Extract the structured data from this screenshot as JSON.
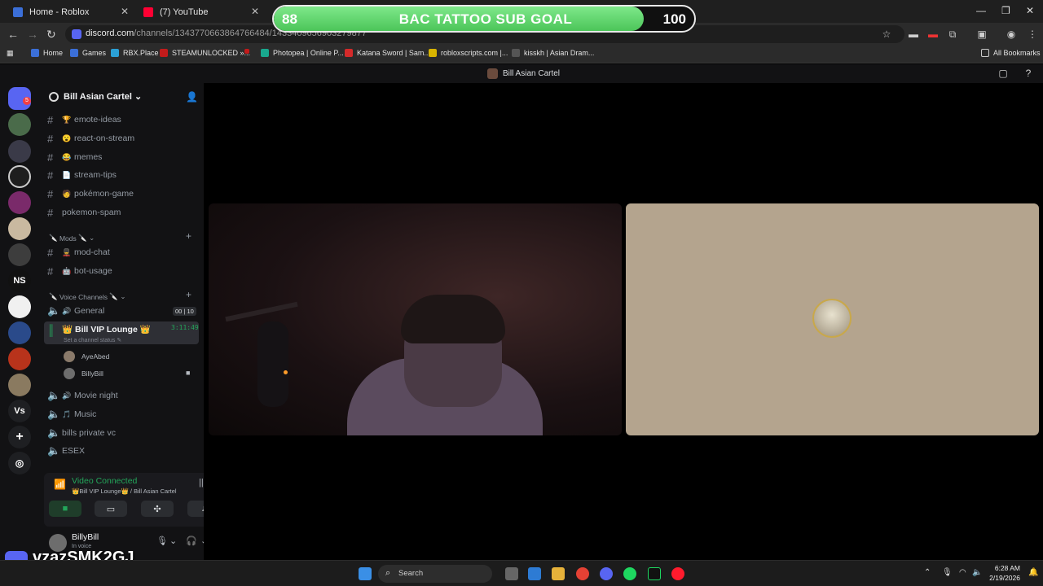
{
  "browser": {
    "tabs": [
      {
        "label": "Home - Roblox",
        "icon": "roblox-icon",
        "color": "#3b6fd8"
      },
      {
        "label": "(7) YouTube",
        "icon": "youtube-icon",
        "color": "#ff0033"
      }
    ],
    "url_main": "discord.com",
    "url_rest": "/channels/1343770663864766484/1433409656903279877",
    "bookmarks": [
      {
        "label": "Home",
        "color": "#3b6fd8"
      },
      {
        "label": "Games",
        "color": "#3b6fd8"
      },
      {
        "label": "RBX.Place",
        "color": "#2ba0d6"
      },
      {
        "label": "STEAMUNLOCKED »...",
        "color": "#c21b1b"
      },
      {
        "label": "Photopea | Online P...",
        "color": "#19a88e"
      },
      {
        "label": "Katana Sword | Sam...",
        "color": "#d42a2a"
      },
      {
        "label": "robloxscripts.com |...",
        "color": "#d8b400"
      },
      {
        "label": "kisskh | Asian Dram...",
        "color": "#555555"
      }
    ],
    "all_bookmarks": "All Bookmarks"
  },
  "goal": {
    "current": "88",
    "title": "BAC TATTOO SUB GOAL",
    "target": "100",
    "progress": 0.88
  },
  "discord": {
    "server_title": "Bill Asian Cartel",
    "server_name": "Bill Asian Cartel",
    "notification_count": "5",
    "text_channels": [
      {
        "emoji": "🏆",
        "name": "emote-ideas"
      },
      {
        "emoji": "😮",
        "name": "react-on-stream"
      },
      {
        "emoji": "😂",
        "name": "memes"
      },
      {
        "emoji": "📄",
        "name": "stream-tips"
      },
      {
        "emoji": "🧑",
        "name": "pokémon-game"
      },
      {
        "emoji": "",
        "name": "pokemon-spam"
      }
    ],
    "mods_category": "Mods",
    "mod_channels": [
      {
        "emoji": "💂",
        "name": "mod-chat"
      },
      {
        "emoji": "🤖",
        "name": "bot-usage"
      }
    ],
    "voice_category": "Voice Channels",
    "voice_general": {
      "emoji": "🔊",
      "name": "General",
      "count_a": "00",
      "count_b": "10"
    },
    "voice_active": {
      "name": "👑 Bill VIP Lounge 👑",
      "timer": "3:11:49",
      "status_hint": "Set a channel status"
    },
    "voice_users": [
      {
        "name": "AyeAbed",
        "color": "#8a7a6a"
      },
      {
        "name": "BillyBill",
        "color": "#6d6d6d"
      }
    ],
    "other_voice": [
      {
        "emoji": "🔊",
        "name": "Movie night"
      },
      {
        "emoji": "🎵",
        "name": "Music"
      },
      {
        "emoji": "",
        "name": "bills private vc"
      },
      {
        "emoji": "",
        "name": "ESEX"
      }
    ],
    "voice_panel": {
      "status": "Video Connected",
      "location": "👑Bill VIP Lounge👑 / Bill Asian Cartel"
    },
    "user": {
      "name": "BillyBill",
      "status": "In voice"
    },
    "guild_labels": {
      "ns": "NS",
      "vs": "Vs"
    }
  },
  "watermark": "vzazSMK2GJ",
  "taskbar": {
    "search_placeholder": "Search",
    "time": "6:28 AM",
    "date": "2/19/2026"
  }
}
